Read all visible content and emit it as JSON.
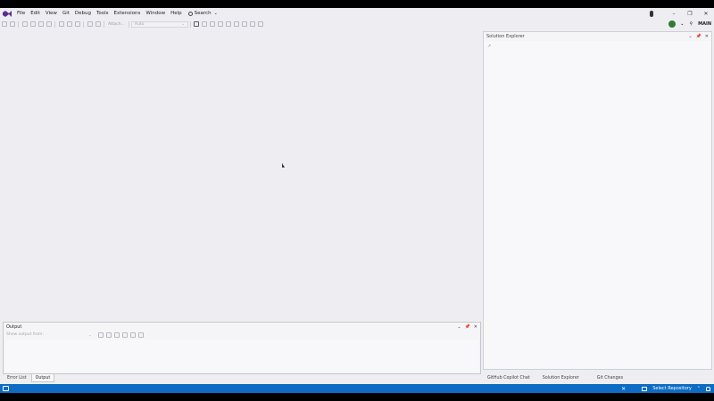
{
  "menubar": {
    "items": [
      "File",
      "Edit",
      "View",
      "Git",
      "Debug",
      "Tools",
      "Extensions",
      "Window",
      "Help"
    ],
    "search_label": "Search",
    "profile_label": "MAIN"
  },
  "toolbar": {
    "start_label": "Attach...",
    "solution_combo": "Auto"
  },
  "solution_explorer": {
    "title": "Solution Explorer"
  },
  "output": {
    "title": "Output",
    "source_label": "Show output from:"
  },
  "bottom_tabs": {
    "error_list": "Error List",
    "output": "Output"
  },
  "right_tabs": {
    "copilot_chat": "GitHub Copilot Chat",
    "solution_explorer": "Solution Explorer",
    "git_changes": "Git Changes"
  },
  "statusbar": {
    "repo_label": "Select Repository"
  },
  "colors": {
    "status_bar": "#0e6cc4",
    "chrome": "#eeeef2",
    "vs_purple": "#5c2d91"
  }
}
